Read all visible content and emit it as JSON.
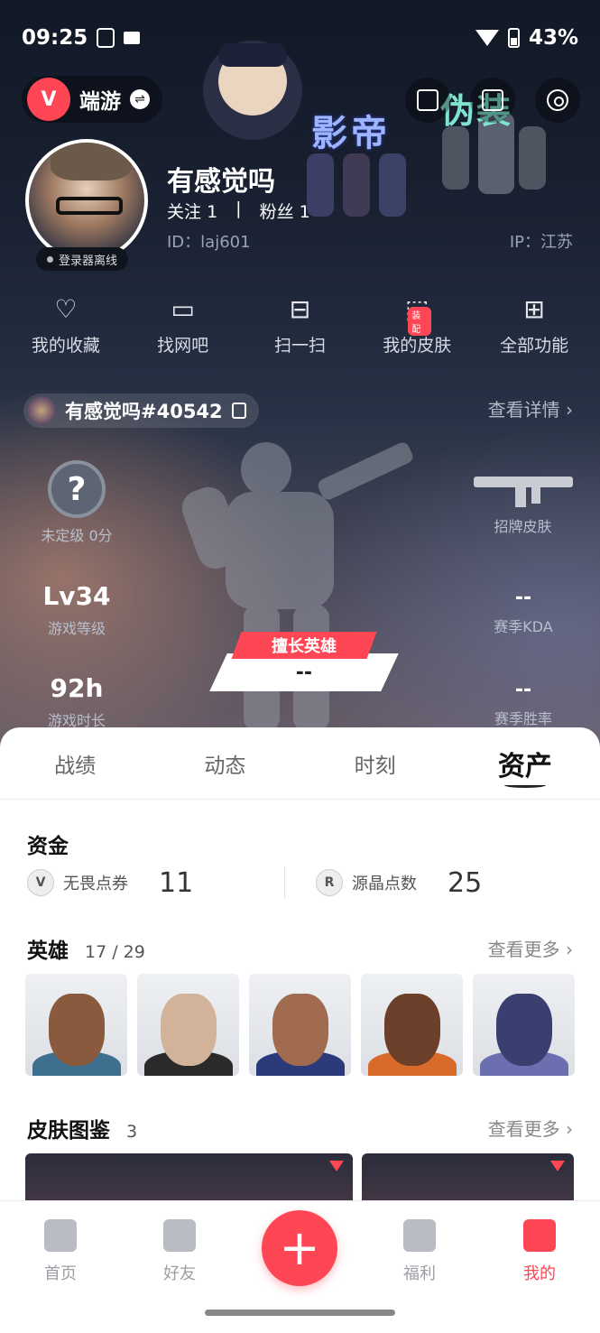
{
  "status": {
    "time": "09:25",
    "battery": "43%"
  },
  "game": {
    "name": "端游",
    "logo_letter": "V"
  },
  "banner": {
    "text_a": "影帝",
    "text_b": "伪装"
  },
  "profile": {
    "username": "有感觉吗",
    "follow_label": "关注",
    "follow_count": "1",
    "divider": "|",
    "fans_label": "粉丝",
    "fans_count": "1",
    "id": "ID：laj601",
    "ip": "IP：江苏",
    "status_badge": "登录器离线"
  },
  "quick_actions": [
    {
      "label": "我的收藏",
      "icon": "heart-icon",
      "glyph": "♡"
    },
    {
      "label": "找网吧",
      "icon": "monitor-icon",
      "glyph": "▭"
    },
    {
      "label": "扫一扫",
      "icon": "scan-icon",
      "glyph": "⊟"
    },
    {
      "label": "我的皮肤",
      "icon": "skin-icon",
      "glyph": "⬚",
      "badge": "装配"
    },
    {
      "label": "全部功能",
      "icon": "grid-icon",
      "glyph": "⊞"
    }
  ],
  "riot_tag": {
    "name": "有感觉吗#40542",
    "view_details": "查看详情 ›"
  },
  "stats": {
    "rank": {
      "icon_text": "?",
      "label": "未定级 0分"
    },
    "level": {
      "value": "Lv34",
      "label": "游戏等级"
    },
    "hours": {
      "value": "92h",
      "label": "游戏时长"
    },
    "signature_skin": {
      "label": "招牌皮肤"
    },
    "kda": {
      "value": "--",
      "label": "赛季KDA"
    },
    "winrate": {
      "value": "--",
      "label": "赛季胜率"
    },
    "best_hero": {
      "ribbon": "擅长英雄",
      "value": "--"
    }
  },
  "tabs": [
    {
      "label": "战绩",
      "active": false
    },
    {
      "label": "动态",
      "active": false
    },
    {
      "label": "时刻",
      "active": false
    },
    {
      "label": "资产",
      "active": true
    }
  ],
  "funds": {
    "title": "资金",
    "items": [
      {
        "icon_text": "V",
        "label": "无畏点券",
        "value": "11"
      },
      {
        "icon_text": "R",
        "label": "源晶点数",
        "value": "25"
      }
    ]
  },
  "agents": {
    "title": "英雄",
    "count": "17 / 29",
    "more": "查看更多 ›",
    "cards": [
      {
        "face": "#8a5a3f",
        "body": "#3f6f8f"
      },
      {
        "face": "#d2b39a",
        "body": "#2a2a2a"
      },
      {
        "face": "#a06b4e",
        "body": "#2b3a7a"
      },
      {
        "face": "#6b3f2a",
        "body": "#d86a2a"
      },
      {
        "face": "#3a3f70",
        "body": "#6b6fb0"
      }
    ]
  },
  "skins": {
    "title": "皮肤图鉴",
    "count": "3",
    "more": "查看更多 ›"
  },
  "bottom_nav": [
    {
      "label": "首页",
      "icon": "home-icon"
    },
    {
      "label": "好友",
      "icon": "friends-icon"
    },
    {
      "label": "福利",
      "icon": "gift-icon"
    },
    {
      "label": "我的",
      "icon": "profile-icon"
    }
  ],
  "colors": {
    "accent": "#ff4655",
    "sheet_bg": "#ffffff",
    "hero_dark": "#111826"
  }
}
